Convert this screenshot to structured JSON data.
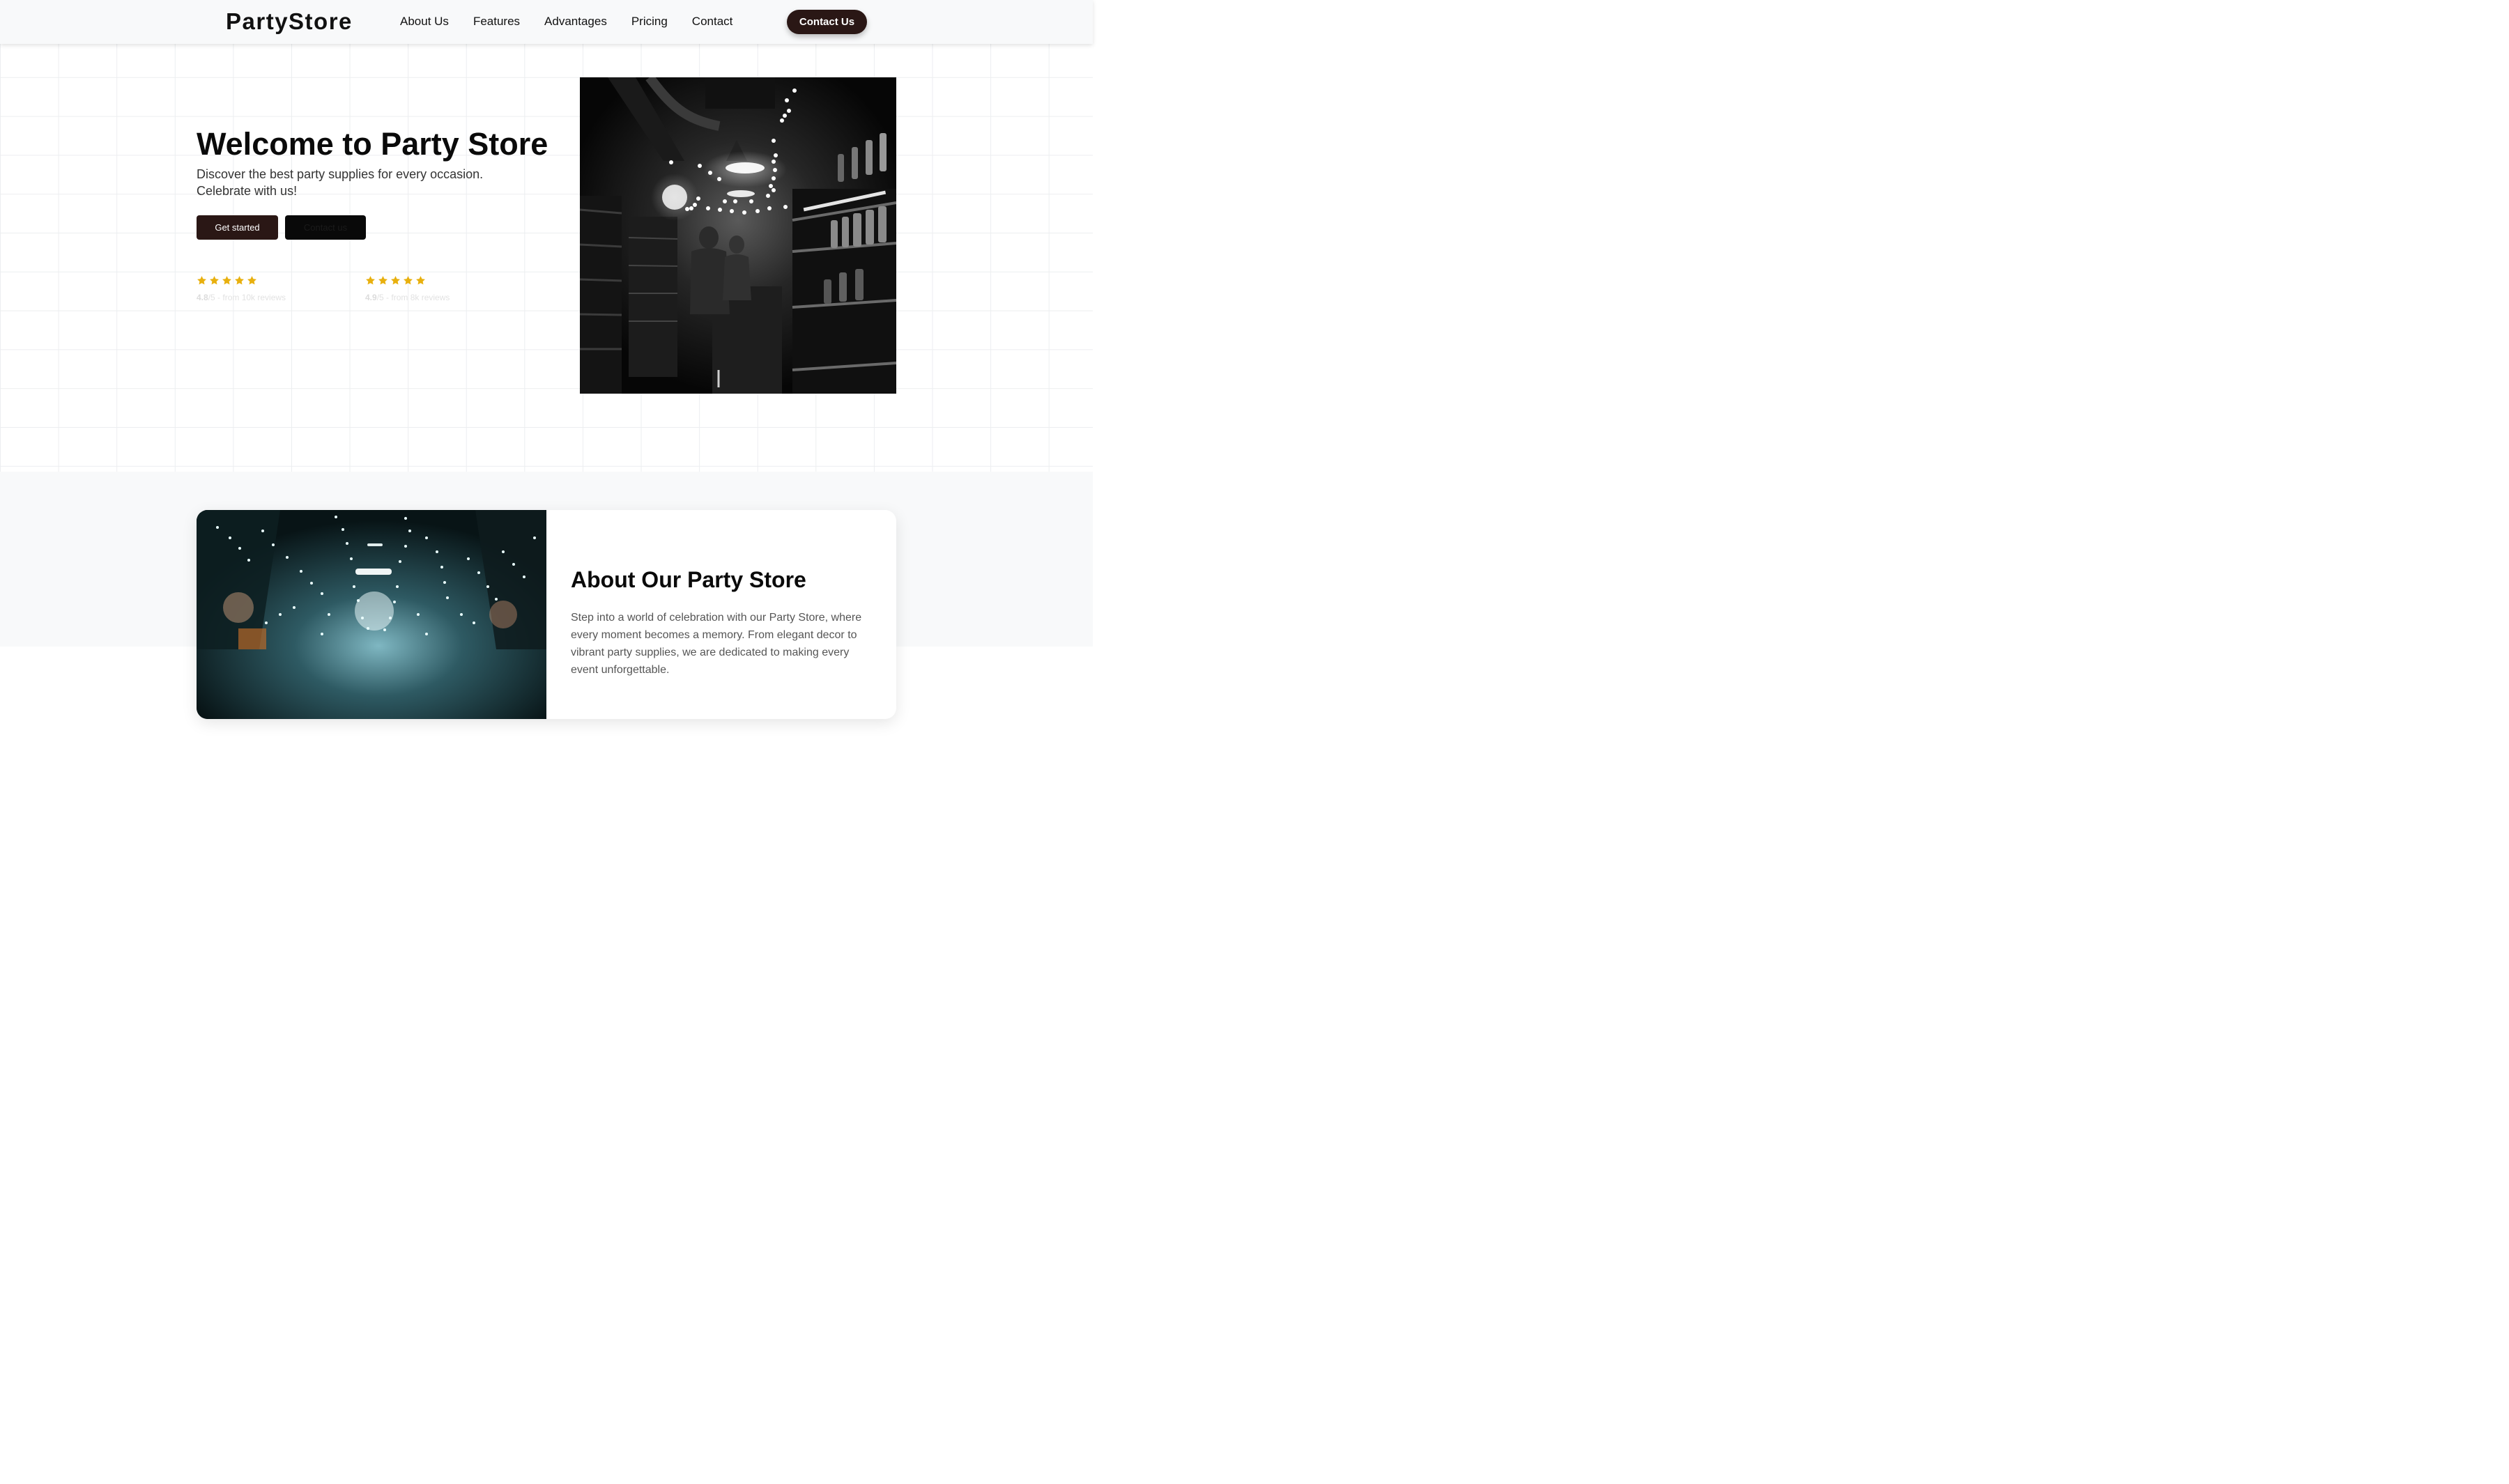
{
  "nav": {
    "brand": "PartyStore",
    "links": [
      "About Us",
      "Features",
      "Advantages",
      "Pricing",
      "Contact"
    ],
    "cta": "Contact Us"
  },
  "hero": {
    "title": "Welcome to Party Store",
    "subtitle": "Discover the best party supplies for every occasion. Celebrate with us!",
    "primary_button": "Get started",
    "secondary_button": "Contact us",
    "ratings": [
      {
        "score": "4.8",
        "suffix": "/5 - from 10k reviews",
        "stars": 5
      },
      {
        "score": "4.9",
        "suffix": "/5 - from 8k reviews",
        "stars": 5
      }
    ],
    "image_icon": "party-store-interior-photo"
  },
  "about": {
    "title": "About Our Party Store",
    "text": "Step into a world of celebration with our Party Store, where every moment becomes a memory. From elegant decor to vibrant party supplies, we are dedicated to making every event unforgettable.",
    "image_icon": "string-lights-photo"
  },
  "colors": {
    "accent_dark": "#2a1715",
    "star": "#e8b00e",
    "nav_bg": "#f8f9fa",
    "grid_line": "#eceef0"
  }
}
